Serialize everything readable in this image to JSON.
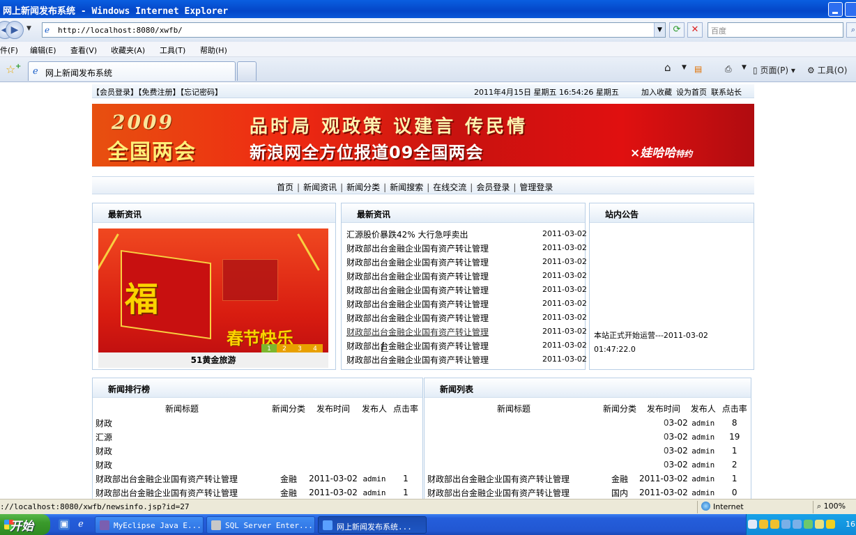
{
  "window": {
    "title": "网上新闻发布系统 - Windows Internet Explorer"
  },
  "browser": {
    "url": "http://localhost:8080/xwfb/",
    "search_placeholder": "百度",
    "menu": [
      "件(F)",
      "编辑(E)",
      "查看(V)",
      "收藏夹(A)",
      "工具(T)",
      "帮助(H)"
    ],
    "tab_title": "网上新闻发布系统",
    "tools": {
      "page": "页面(P)",
      "tools": "工具(O)"
    }
  },
  "site": {
    "top_links": {
      "login": "【会员登录】",
      "register": "【免费注册】",
      "forgot": "【忘记密码】"
    },
    "datetime": "2011年4月15日 星期五 16:54:26  星期五",
    "right_links": [
      "加入收藏",
      "设为首页",
      "联系站长"
    ],
    "banner": {
      "year": "2009",
      "meeting": "全国两会",
      "slogan_top": "品时局 观政策 议建言 传民情",
      "slogan_bottom": "新浪网全方位报道09全国两会",
      "sponsor_name": "×娃哈哈",
      "sponsor_suffix": "特约"
    },
    "nav": [
      "首页",
      "新闻资讯",
      "新闻分类",
      "新闻搜索",
      "在线交流",
      "会员登录",
      "管理登录"
    ],
    "left_box": {
      "title": "最新资讯",
      "image_main": "福",
      "image_text": "春节快乐",
      "image_pager": [
        "1",
        "2",
        "3",
        "4"
      ],
      "caption": "51黄金旅游"
    },
    "mid_box": {
      "title": "最新资讯",
      "items": [
        {
          "title": "汇源股价暴跌42% 大行急呼卖出",
          "date": "2011-03-02"
        },
        {
          "title": "财政部出台金融企业国有资产转让管理",
          "date": "2011-03-02"
        },
        {
          "title": "财政部出台金融企业国有资产转让管理",
          "date": "2011-03-02"
        },
        {
          "title": "财政部出台金融企业国有资产转让管理",
          "date": "2011-03-02"
        },
        {
          "title": "财政部出台金融企业国有资产转让管理",
          "date": "2011-03-02"
        },
        {
          "title": "财政部出台金融企业国有资产转让管理",
          "date": "2011-03-02"
        },
        {
          "title": "财政部出台金融企业国有资产转让管理",
          "date": "2011-03-02"
        },
        {
          "title": "财政部出台金融企业国有资产转让管理",
          "date": "2011-03-02"
        },
        {
          "title": "财政部出台金融企业国有资产转让管理",
          "date": "2011-03-02"
        },
        {
          "title": "财政部出台金融企业国有资产转让管理",
          "date": "2011-03-02"
        }
      ]
    },
    "right_box": {
      "title": "站内公告",
      "notice_line1": "本站正式开始运营---2011-03-02",
      "notice_line2": "01:47:22.0"
    },
    "ranking": {
      "title": "新闻排行榜",
      "headers": [
        "新闻标题",
        "新闻分类",
        "发布时间",
        "发布人",
        "点击率"
      ],
      "rows": [
        [
          "财政",
          "",
          "",
          "",
          ""
        ],
        [
          "汇源",
          "",
          "",
          "",
          ""
        ],
        [
          "财政",
          "",
          "",
          "",
          ""
        ],
        [
          "财政",
          "",
          "",
          "",
          ""
        ],
        [
          "财政部出台金融企业国有资产转让管理",
          "金融",
          "2011-03-02",
          "admin",
          "1"
        ],
        [
          "财政部出台金融企业国有资产转让管理",
          "金融",
          "2011-03-02",
          "admin",
          "1"
        ]
      ]
    },
    "newslist": {
      "title": "新闻列表",
      "headers": [
        "新闻标题",
        "新闻分类",
        "发布时间",
        "发布人",
        "点击率"
      ],
      "rows": [
        [
          "",
          "",
          "03-02",
          "admin",
          "8"
        ],
        [
          "",
          "",
          "03-02",
          "admin",
          "19"
        ],
        [
          "",
          "",
          "03-02",
          "admin",
          "1"
        ],
        [
          "",
          "",
          "03-02",
          "admin",
          "2"
        ],
        [
          "财政部出台金融企业国有资产转让管理",
          "金融",
          "2011-03-02",
          "admin",
          "1"
        ],
        [
          "财政部出台金融企业国有资产转让管理",
          "国内",
          "2011-03-02",
          "admin",
          "0"
        ]
      ]
    }
  },
  "status": {
    "url": "://localhost:8080/xwfb/newsinfo.jsp?id=27",
    "zone": "Internet",
    "zoom": "100%"
  },
  "taskbar": {
    "start": "开始",
    "tasks": [
      "MyEclipse Java E...",
      "SQL Server Enter...",
      "网上新闻发布系统..."
    ],
    "clock": "16"
  }
}
